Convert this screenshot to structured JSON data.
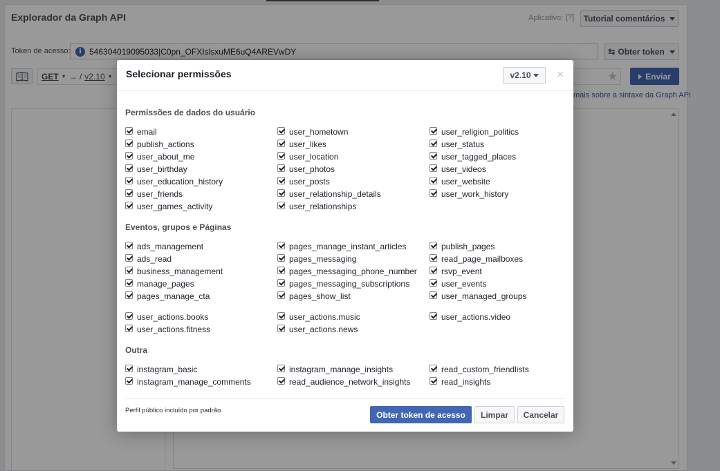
{
  "app": {
    "title": "Explorador da Graph API",
    "app_label": "Aplicativo:",
    "help": "[?]",
    "app_selector": "Tutorial comentários",
    "token_label": "Token de acesso:",
    "token_value": "546304019095033|C0pn_OFXIslsxuME6uQ4AREVwDY",
    "get_token_button": "Obter token",
    "method": "GET",
    "arrow": "→ /",
    "version": "v2.10",
    "send_button": "Enviar",
    "syntax_link": "mais sobre a sintaxe da Graph API"
  },
  "modal": {
    "title": "Selecionar permissões",
    "version": "v2.10",
    "close": "×",
    "sections": [
      {
        "title": "Permissões de dados do usuário",
        "columns": [
          [
            "email",
            "publish_actions",
            "user_about_me",
            "user_birthday",
            "user_education_history",
            "user_friends",
            "user_games_activity"
          ],
          [
            "user_hometown",
            "user_likes",
            "user_location",
            "user_photos",
            "user_posts",
            "user_relationship_details",
            "user_relationships"
          ],
          [
            "user_religion_politics",
            "user_status",
            "user_tagged_places",
            "user_videos",
            "user_website",
            "user_work_history"
          ]
        ]
      },
      {
        "title": "Eventos, grupos e Páginas",
        "columns": [
          [
            "ads_management",
            "ads_read",
            "business_management",
            "manage_pages",
            "pages_manage_cta"
          ],
          [
            "pages_manage_instant_articles",
            "pages_messaging",
            "pages_messaging_phone_number",
            "pages_messaging_subscriptions",
            "pages_show_list"
          ],
          [
            "publish_pages",
            "read_page_mailboxes",
            "rsvp_event",
            "user_events",
            "user_managed_groups"
          ]
        ]
      },
      {
        "title": "",
        "columns": [
          [
            "user_actions.books",
            "user_actions.fitness"
          ],
          [
            "user_actions.music",
            "user_actions.news"
          ],
          [
            "user_actions.video"
          ]
        ]
      },
      {
        "title": "Outra",
        "columns": [
          [
            "instagram_basic",
            "instagram_manage_comments"
          ],
          [
            "instagram_manage_insights",
            "read_audience_network_insights"
          ],
          [
            "read_custom_friendlists",
            "read_insights"
          ]
        ]
      }
    ],
    "footer_note": "Perfil público incluído por padrão",
    "primary_button": "Obter token de acesso",
    "clear_button": "Limpar",
    "cancel_button": "Cancelar"
  }
}
